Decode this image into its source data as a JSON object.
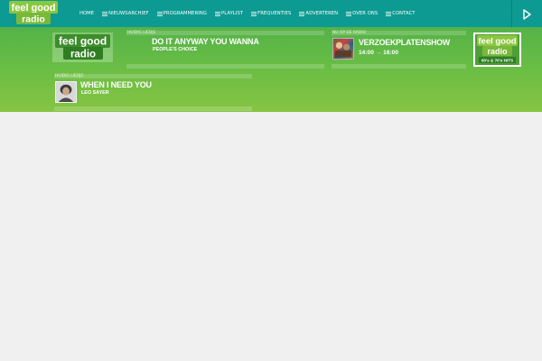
{
  "brand": {
    "logo_text_top": "feel good",
    "logo_text_bottom": "radio",
    "accent": "#0d9a92",
    "green": "#68bd45"
  },
  "nav": {
    "items": [
      {
        "label": "HOME",
        "icon": ""
      },
      {
        "label": "NIEUWSARCHIEF",
        "icon": "list-icon"
      },
      {
        "label": "PROGRAMMERING",
        "icon": "list-icon"
      },
      {
        "label": "PLAYLIST",
        "icon": "list-icon"
      },
      {
        "label": "FREQUENTIES",
        "icon": "list-icon"
      },
      {
        "label": "ADVERTEREN",
        "icon": "list-icon"
      },
      {
        "label": "OVER ONS",
        "icon": "list-icon"
      },
      {
        "label": "CONTACT",
        "icon": "list-icon"
      }
    ],
    "play_icon": "play-icon"
  },
  "now_playing": {
    "caption": "HUIDIG LIEDJE",
    "title": "DO IT ANYWAY YOU WANNA",
    "artist": "PEOPLE'S CHOICE"
  },
  "on_air": {
    "caption": "NU OP DE RADIO",
    "show": "VERZOEKPLATENSHOW",
    "start": "14:00",
    "arrow": "→",
    "end": "16:00"
  },
  "station_logo": {
    "text_top": "feel good",
    "text_bottom": "radio",
    "tagline": "60's & 70's HITS"
  },
  "current_song": {
    "caption": "HUIDIG LIEDJE",
    "title": "WHEN I NEED YOU",
    "artist": "LEO SAYER"
  }
}
